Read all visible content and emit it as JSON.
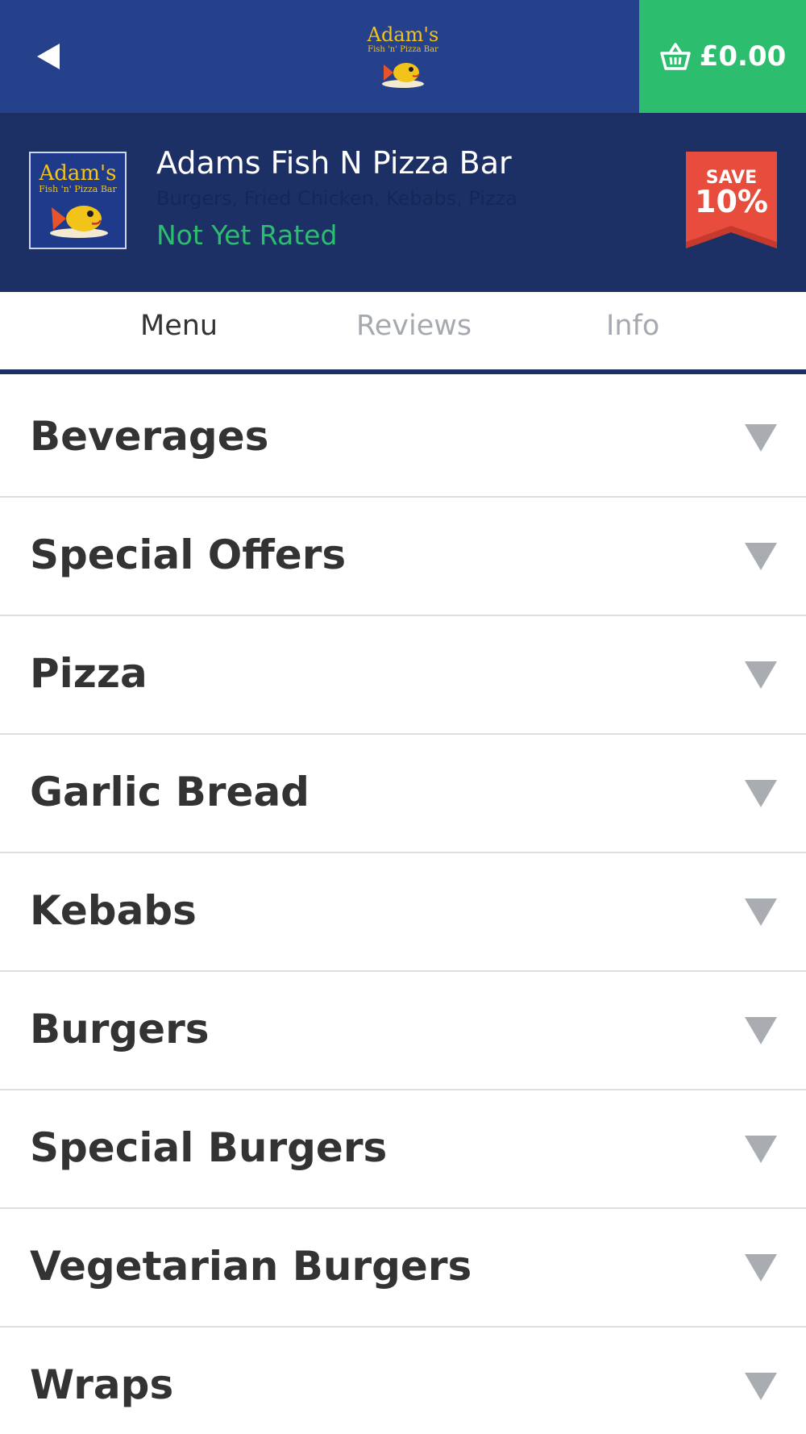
{
  "header": {
    "back_icon": "back-arrow-icon",
    "logo": {
      "line1": "Adam's",
      "line2": "Fish 'n' Pizza Bar"
    },
    "basket": {
      "icon": "basket-icon",
      "total": "£0.00"
    },
    "colors": {
      "bar": "#26418b",
      "basket": "#2dbd6e"
    }
  },
  "restaurant": {
    "logo": {
      "line1": "Adam's",
      "line2": "Fish 'n' Pizza Bar"
    },
    "name": "Adams Fish N Pizza Bar",
    "cuisine": "Burgers, Fried Chicken, Kebabs, Pizza",
    "rating": "Not Yet Rated",
    "badge": {
      "label": "SAVE",
      "value": "10%",
      "color": "#e84c3d"
    }
  },
  "tabs": [
    {
      "label": "Menu",
      "active": true
    },
    {
      "label": "Reviews",
      "active": false
    },
    {
      "label": "Info",
      "active": false
    }
  ],
  "categories": [
    {
      "name": "Beverages"
    },
    {
      "name": "Special Offers"
    },
    {
      "name": "Pizza"
    },
    {
      "name": "Garlic Bread"
    },
    {
      "name": "Kebabs"
    },
    {
      "name": "Burgers"
    },
    {
      "name": "Special Burgers"
    },
    {
      "name": "Vegetarian Burgers"
    },
    {
      "name": "Wraps"
    }
  ],
  "category_icon": "chevron-down-icon"
}
